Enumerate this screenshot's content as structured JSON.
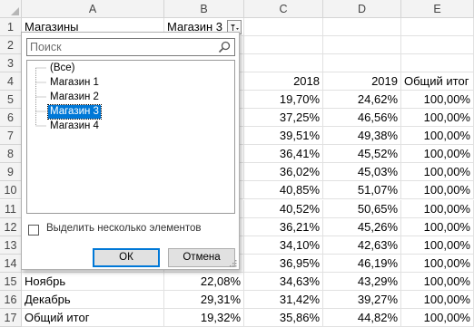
{
  "columns": [
    "A",
    "B",
    "C",
    "D",
    "E"
  ],
  "rows": [
    {
      "n": "1",
      "a": "Магазины",
      "b": "Магазин 3",
      "c": "",
      "d": "",
      "e": ""
    },
    {
      "n": "2",
      "a": "",
      "b": "",
      "c": "",
      "d": "",
      "e": ""
    },
    {
      "n": "3",
      "a": "",
      "b": "",
      "c": "",
      "d": "",
      "e": ""
    },
    {
      "n": "4",
      "a": "",
      "b": "",
      "c": "2018",
      "d": "2019",
      "e": "Общий итог"
    },
    {
      "n": "5",
      "a": "",
      "b": "",
      "c": "19,70%",
      "d": "24,62%",
      "e": "100,00%"
    },
    {
      "n": "6",
      "a": "",
      "b": "",
      "c": "37,25%",
      "d": "46,56%",
      "e": "100,00%"
    },
    {
      "n": "7",
      "a": "",
      "b": "",
      "c": "39,51%",
      "d": "49,38%",
      "e": "100,00%"
    },
    {
      "n": "8",
      "a": "",
      "b": "",
      "c": "36,41%",
      "d": "45,52%",
      "e": "100,00%"
    },
    {
      "n": "9",
      "a": "",
      "b": "",
      "c": "36,02%",
      "d": "45,03%",
      "e": "100,00%"
    },
    {
      "n": "10",
      "a": "",
      "b": "",
      "c": "40,85%",
      "d": "51,07%",
      "e": "100,00%"
    },
    {
      "n": "11",
      "a": "",
      "b": "",
      "c": "40,52%",
      "d": "50,65%",
      "e": "100,00%"
    },
    {
      "n": "12",
      "a": "",
      "b": "",
      "c": "36,21%",
      "d": "45,26%",
      "e": "100,00%"
    },
    {
      "n": "13",
      "a": "",
      "b": "",
      "c": "34,10%",
      "d": "42,63%",
      "e": "100,00%"
    },
    {
      "n": "14",
      "a": "",
      "b": "",
      "c": "36,95%",
      "d": "46,19%",
      "e": "100,00%"
    },
    {
      "n": "15",
      "a": "Ноябрь",
      "b": "22,08%",
      "c": "34,63%",
      "d": "43,29%",
      "e": "100,00%"
    },
    {
      "n": "16",
      "a": "Декабрь",
      "b": "29,31%",
      "c": "31,42%",
      "d": "39,27%",
      "e": "100,00%"
    },
    {
      "n": "17",
      "a": "Общий итог",
      "b": "19,32%",
      "c": "35,86%",
      "d": "44,82%",
      "e": "100,00%"
    }
  ],
  "filter_dropdown": {
    "search_placeholder": "Поиск",
    "items": [
      {
        "label": "(Все)",
        "selected": false
      },
      {
        "label": "Магазин 1",
        "selected": false
      },
      {
        "label": "Магазин 2",
        "selected": false
      },
      {
        "label": "Магазин 3",
        "selected": true
      },
      {
        "label": "Магазин 4",
        "selected": false
      }
    ],
    "multi_select_label": "Выделить несколько элементов",
    "multi_select_checked": false,
    "ok_label": "ОК",
    "cancel_label": "Отмена"
  },
  "colors": {
    "selection": "#0078d7",
    "header_bg": "#f3f3f3",
    "gridline": "#e1e1e1"
  },
  "icons": [
    "search-icon",
    "filter-dropdown-icon",
    "resize-grip-icon",
    "select-all-corner-icon"
  ]
}
